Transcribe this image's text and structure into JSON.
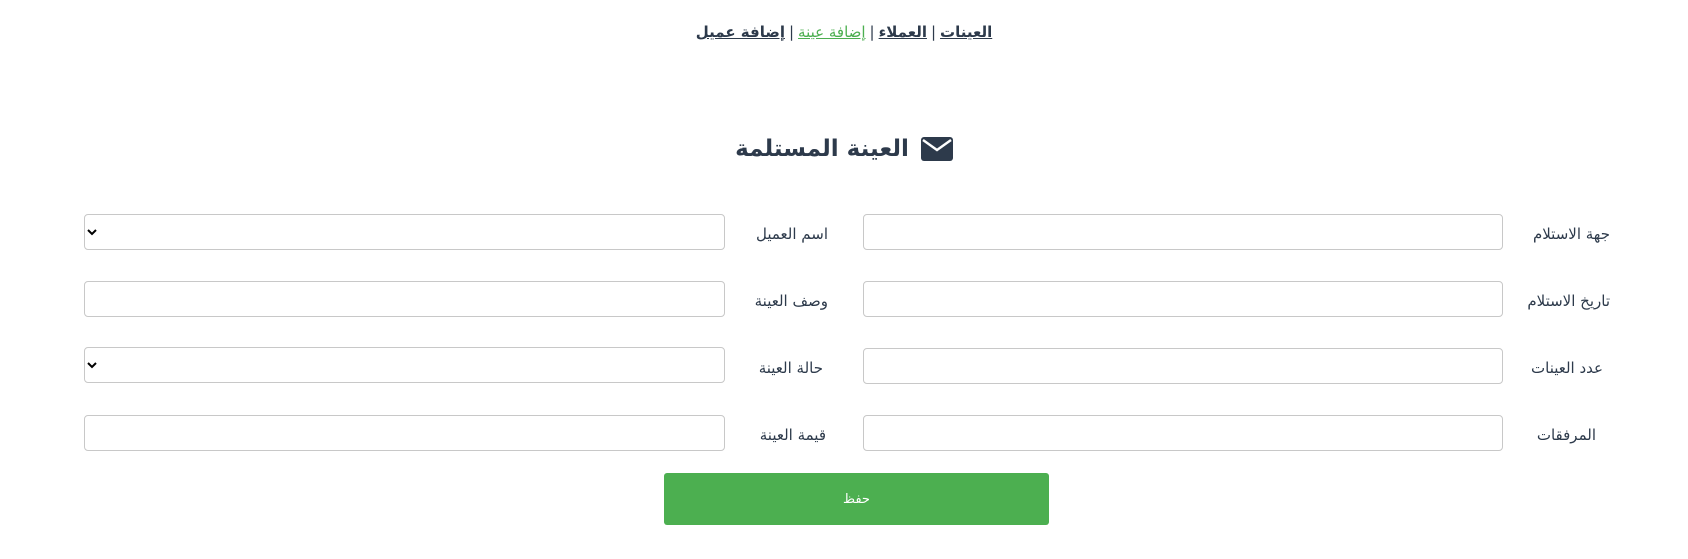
{
  "nav": {
    "items": [
      {
        "label": "العينات",
        "active": false
      },
      {
        "label": "العملاء",
        "active": false
      },
      {
        "label": "إضافة عينة",
        "active": true
      },
      {
        "label": "إضافة عميل",
        "active": false
      }
    ],
    "separator": "|"
  },
  "form": {
    "title": "العينة المستلمة",
    "title_icon": "envelope-icon",
    "fields": {
      "receiving_party": {
        "label": "جهة الاستلام",
        "value": ""
      },
      "client_name": {
        "label": "اسم العميل",
        "selected": ""
      },
      "receiving_date": {
        "label": "تاريخ الاستلام",
        "value": ""
      },
      "sample_description": {
        "label": "وصف العينة",
        "value": ""
      },
      "sample_count": {
        "label": "عدد العينات",
        "value": ""
      },
      "sample_status": {
        "label": "حالة العينة",
        "selected": ""
      },
      "attachments": {
        "label": "المرفقات",
        "value": ""
      },
      "sample_value": {
        "label": "قيمة العينة",
        "value": ""
      }
    },
    "save_label": "حفظ"
  },
  "colors": {
    "accent": "#4caf50",
    "text": "#2d3a4b",
    "border": "#c8c8c8"
  }
}
